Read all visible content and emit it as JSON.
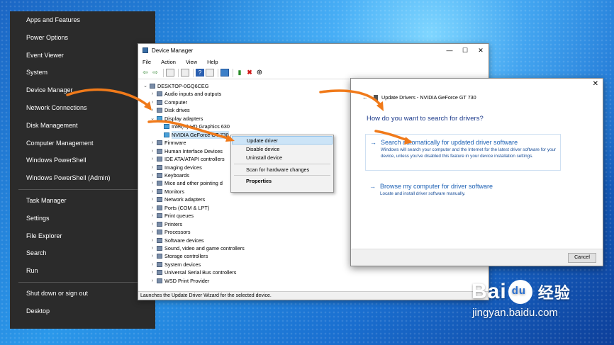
{
  "winx_menu": {
    "group1": [
      "Apps and Features",
      "Power Options",
      "Event Viewer",
      "System",
      "Device Manager",
      "Network Connections",
      "Disk Management",
      "Computer Management",
      "Windows PowerShell",
      "Windows PowerShell (Admin)"
    ],
    "group2": [
      "Task Manager",
      "Settings",
      "File Explorer",
      "Search",
      "Run"
    ],
    "group3": [
      "Shut down or sign out",
      "Desktop"
    ]
  },
  "device_manager": {
    "title": "Device Manager",
    "menu": [
      "File",
      "Action",
      "View",
      "Help"
    ],
    "tree": [
      {
        "label": "DESKTOP-0GQ6CEG",
        "exp": "⌄",
        "icon": "computer-icon"
      },
      {
        "label": "Audio inputs and outputs",
        "exp": "›",
        "icon": "audio-icon"
      },
      {
        "label": "Computer",
        "exp": "›",
        "icon": "computer-icon"
      },
      {
        "label": "Disk drives",
        "exp": "›",
        "icon": "disk-icon"
      },
      {
        "label": "Display adapters",
        "exp": "⌄",
        "icon": "display-adapter-icon"
      },
      {
        "label": "Intel(R) HD Graphics 630",
        "exp": "",
        "icon": "display-adapter-icon"
      },
      {
        "label": "NVIDIA GeForce GT 730",
        "exp": "",
        "icon": "display-adapter-icon"
      },
      {
        "label": "Firmware",
        "exp": "›",
        "icon": "firmware-icon"
      },
      {
        "label": "Human Interface Devices",
        "exp": "›",
        "icon": "hid-icon"
      },
      {
        "label": "IDE ATA/ATAPI controllers",
        "exp": "›",
        "icon": "ide-icon"
      },
      {
        "label": "Imaging devices",
        "exp": "›",
        "icon": "camera-icon"
      },
      {
        "label": "Keyboards",
        "exp": "›",
        "icon": "keyboard-icon"
      },
      {
        "label": "Mice and other pointing d",
        "exp": "›",
        "icon": "mouse-icon"
      },
      {
        "label": "Monitors",
        "exp": "›",
        "icon": "monitor-icon"
      },
      {
        "label": "Network adapters",
        "exp": "›",
        "icon": "network-icon"
      },
      {
        "label": "Ports (COM & LPT)",
        "exp": "›",
        "icon": "port-icon"
      },
      {
        "label": "Print queues",
        "exp": "›",
        "icon": "printer-icon"
      },
      {
        "label": "Printers",
        "exp": "›",
        "icon": "printer-icon"
      },
      {
        "label": "Processors",
        "exp": "›",
        "icon": "processor-icon"
      },
      {
        "label": "Software devices",
        "exp": "›",
        "icon": "software-icon"
      },
      {
        "label": "Sound, video and game controllers",
        "exp": "›",
        "icon": "sound-icon"
      },
      {
        "label": "Storage controllers",
        "exp": "›",
        "icon": "storage-icon"
      },
      {
        "label": "System devices",
        "exp": "›",
        "icon": "system-icon"
      },
      {
        "label": "Universal Serial Bus controllers",
        "exp": "›",
        "icon": "usb-icon"
      },
      {
        "label": "WSD Print Provider",
        "exp": "›",
        "icon": "printer-icon"
      }
    ],
    "status": "Launches the Update Driver Wizard for the selected device."
  },
  "context_menu": {
    "items": [
      "Update driver",
      "Disable device",
      "Uninstall device",
      "Scan for hardware changes",
      "Properties"
    ]
  },
  "update_dialog": {
    "header": "Update Drivers - NVIDIA GeForce GT 730",
    "question": "How do you want to search for drivers?",
    "option1_title": "Search automatically for updated driver software",
    "option1_desc": "Windows will search your computer and the Internet for the latest driver software for your device, unless you've disabled this feature in your device installation settings.",
    "option2_title": "Browse my computer for driver software",
    "option2_desc": "Locate and install driver software manually.",
    "cancel": "Cancel"
  },
  "watermark": {
    "brand_left": "Bai",
    "brand_cn": "经验",
    "url": "jingyan.baidu.com"
  },
  "colors": {
    "arrow": "#f07a1a",
    "link": "#1a5fb4",
    "menu_bg": "#2b2b2b"
  }
}
